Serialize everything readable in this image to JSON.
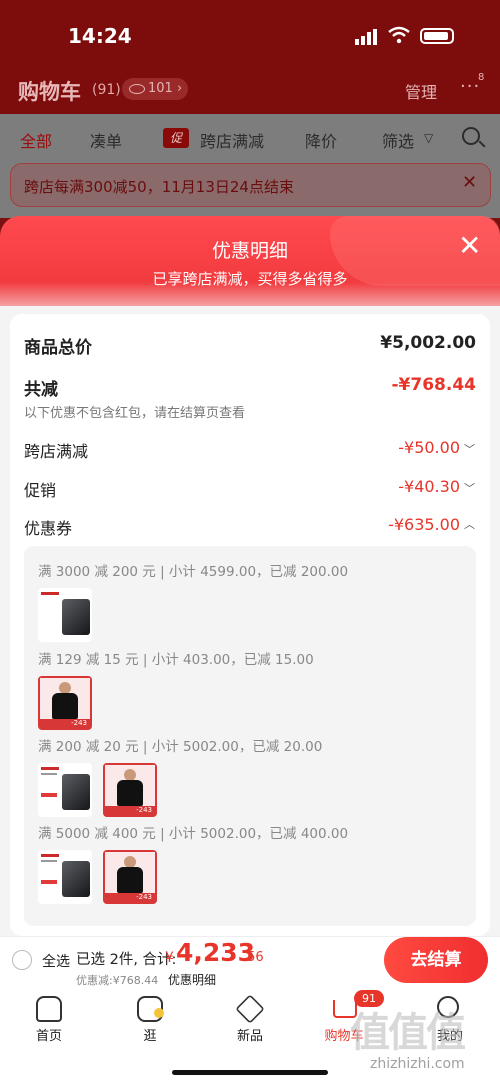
{
  "status_bar": {
    "time": "14:24"
  },
  "header": {
    "title": "购物车",
    "count": "(91)",
    "views": "101",
    "manage": "管理",
    "more_badge": "8"
  },
  "filter_tabs": {
    "all": "全部",
    "cou": "凑单",
    "promo_tag": "促",
    "cross": "跨店满减",
    "price": "降价",
    "filter": "筛选"
  },
  "banner": {
    "text": "跨店每满300减50，11月13日24点结束"
  },
  "sheet": {
    "title": "优惠明细",
    "subtitle": "已享跨店满减，买得多省得多",
    "total_label": "商品总价",
    "total_value": "¥5,002.00",
    "reduce_label": "共减",
    "reduce_value": "-¥768.44",
    "reduce_note": "以下优惠不包含红包，请在结算页查看",
    "cross_label": "跨店满减",
    "cross_value": "-¥50.00",
    "promo_label": "促销",
    "promo_value": "-¥40.30",
    "coupon_label": "优惠券",
    "coupon_value": "-¥635.00",
    "coupon_rules": [
      {
        "rule": "满 3000 减 200 元 | 小计 4599.00，已减 200.00"
      },
      {
        "rule": "满 129 减 15 元 | 小计 403.00，已减 15.00"
      },
      {
        "rule": "满 200 减 20 元 | 小计 5002.00，已减 20.00"
      },
      {
        "rule": "满 5000 减 400 元 | 小计 5002.00，已减 400.00"
      }
    ],
    "shirt_tag": "-243"
  },
  "bottom_bar": {
    "select_all": "全选",
    "selected_text": "已选 2件, 合计:",
    "yen": "¥",
    "amount_int": "4,233",
    "amount_dec": ".56",
    "discount_text": "优惠减:¥768.44",
    "detail_link": "优惠明细",
    "checkout": "去结算"
  },
  "tabbar": {
    "home": "首页",
    "guang": "逛",
    "new": "新品",
    "cart": "购物车",
    "cart_badge": "91",
    "me": "我的"
  },
  "watermark": {
    "text": "值值值",
    "url": "zhizhizhi.com"
  }
}
